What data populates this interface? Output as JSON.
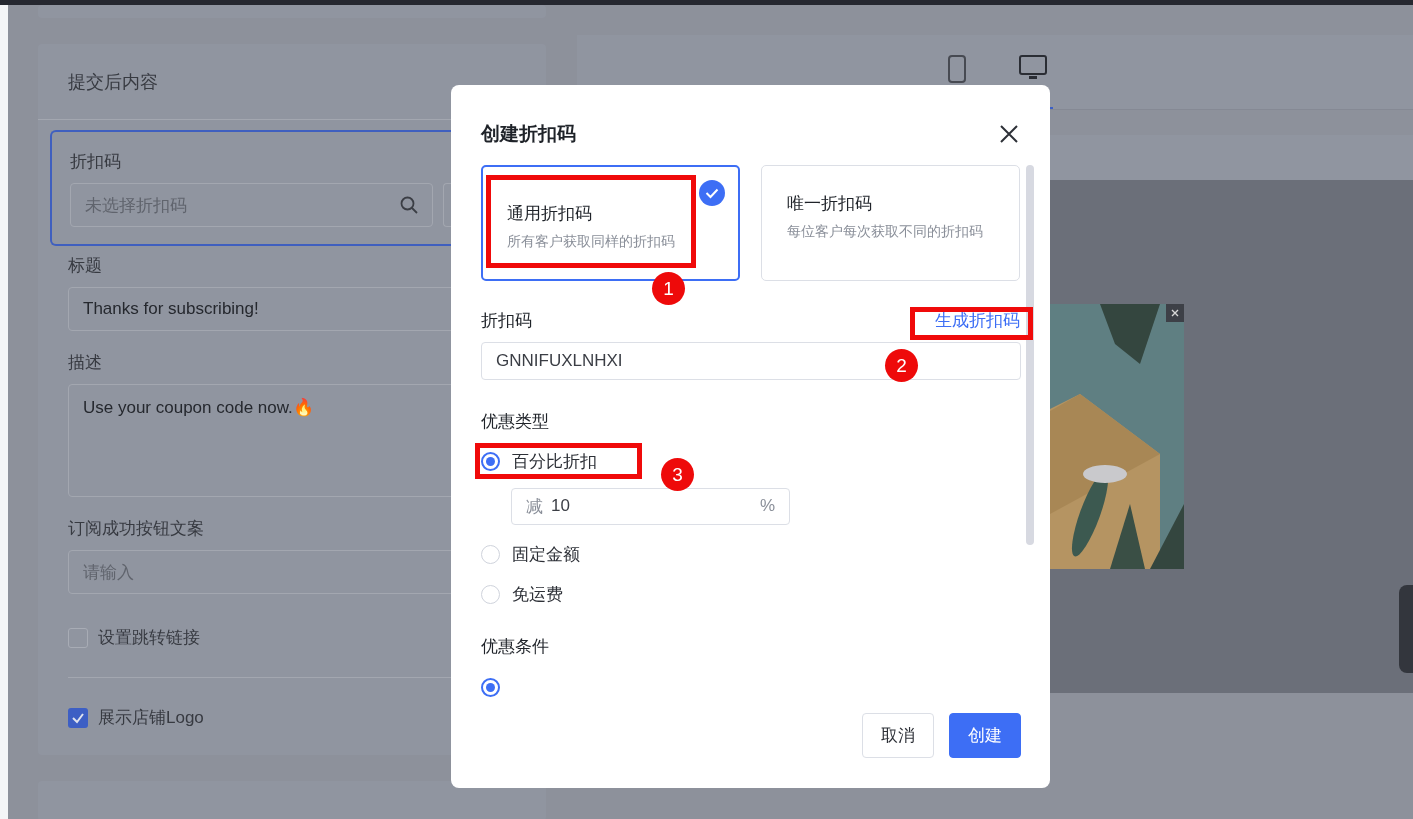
{
  "left_panel": {
    "title": "提交后内容",
    "fields": [
      {
        "kind": "search",
        "label": "折扣码",
        "placeholder": "未选择折扣码",
        "selected": true
      },
      {
        "kind": "input",
        "label": "标题",
        "value": "Thanks for subscribing!",
        "selected": false
      },
      {
        "kind": "textarea",
        "label": "描述",
        "value": "Use your coupon code now.🔥",
        "selected": false
      },
      {
        "kind": "input",
        "label": "订阅成功按钮文案",
        "placeholder": "请输入",
        "selected": false
      }
    ],
    "checkboxes": [
      {
        "label": "设置跳转链接",
        "checked": false
      },
      {
        "label": "展示店铺Logo",
        "checked": true
      }
    ]
  },
  "preview": {
    "devices": [
      {
        "kind": "phone",
        "selected": false
      },
      {
        "kind": "desktop",
        "selected": true
      }
    ]
  },
  "modal": {
    "title": "创建折扣码",
    "type_cards": [
      {
        "title": "通用折扣码",
        "description": "所有客户获取同样的折扣码",
        "selected": true
      },
      {
        "title": "唯一折扣码",
        "description": "每位客户每次获取不同的折扣码",
        "selected": false
      }
    ],
    "code_label": "折扣码",
    "generate_link": "生成折扣码",
    "code_value": "GNNIFUXLNHXI",
    "discount_type_label": "优惠类型",
    "discount_options": [
      {
        "label": "百分比折扣",
        "selected": true,
        "amount": {
          "prefix": "减",
          "value": "10",
          "suffix": "%"
        }
      },
      {
        "label": "固定金额",
        "selected": false
      },
      {
        "label": "免运费",
        "selected": false
      }
    ],
    "condition_label": "优惠条件",
    "condition_options": [
      {
        "selected": true
      }
    ],
    "buttons": [
      {
        "label": "取消",
        "kind": "secondary"
      },
      {
        "label": "创建",
        "kind": "primary"
      }
    ]
  },
  "annotations": [
    {
      "label": "1"
    },
    {
      "label": "2"
    },
    {
      "label": "3"
    }
  ]
}
